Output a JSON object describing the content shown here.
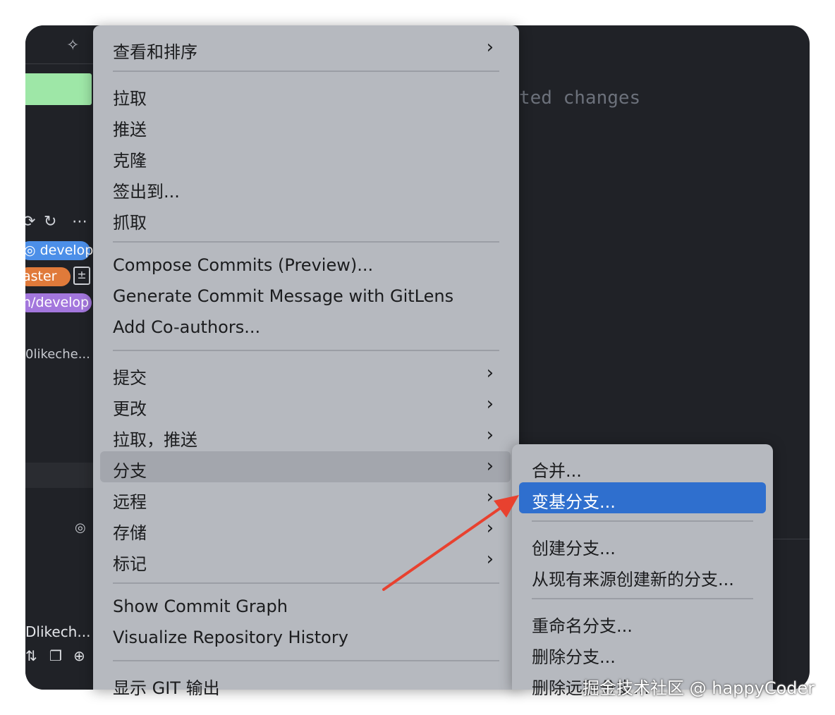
{
  "background_editor_text": "ted changes",
  "sidebar": {
    "branch_labels": [
      "develop",
      "aster",
      "n/develop"
    ],
    "author_top": "0likeche...",
    "author_bottom": "Dlikech...",
    "icons": [
      "sparkle-icon",
      "sync-icon",
      "refresh-icon",
      "more-icon",
      "stash-icon",
      "radio-icon",
      "pull-request-icon",
      "copy-icon",
      "globe-icon"
    ]
  },
  "menu": {
    "items": [
      {
        "label": "查看和排序",
        "submenu": true
      },
      {
        "label": "拉取"
      },
      {
        "label": "推送"
      },
      {
        "label": "克隆"
      },
      {
        "label": "签出到..."
      },
      {
        "label": "抓取"
      },
      {
        "label": "Compose Commits (Preview)..."
      },
      {
        "label": "Generate Commit Message with GitLens"
      },
      {
        "label": "Add Co-authors..."
      },
      {
        "label": "提交",
        "submenu": true
      },
      {
        "label": "更改",
        "submenu": true
      },
      {
        "label": "拉取，推送",
        "submenu": true
      },
      {
        "label": "分支",
        "submenu": true,
        "highlighted": true
      },
      {
        "label": "远程",
        "submenu": true
      },
      {
        "label": "存储",
        "submenu": true
      },
      {
        "label": "标记",
        "submenu": true
      },
      {
        "label": "Show Commit Graph"
      },
      {
        "label": "Visualize Repository History"
      },
      {
        "label": "显示 GIT 输出"
      }
    ],
    "chevron": "›"
  },
  "submenu": {
    "items": [
      {
        "label": "合并..."
      },
      {
        "label": "变基分支...",
        "selected": true
      },
      {
        "label": "创建分支..."
      },
      {
        "label": "从现有来源创建新的分支..."
      },
      {
        "label": "重命名分支..."
      },
      {
        "label": "删除分支..."
      },
      {
        "label": "删除远程分支..."
      }
    ]
  },
  "annotation": {
    "arrow_color": "#e8412f"
  },
  "watermark": "掘金技术社区 @ happyCoder",
  "colors": {
    "menu_bg": "#b6b9bf",
    "selected_bg": "#2f6fce",
    "highlight_bg": "#a3a6ad",
    "window_bg": "#202227",
    "pill_develop": "#4c8fe8",
    "pill_master": "#e07a3a",
    "pill_origin": "#a377dd",
    "green_bar": "#9ee7a7"
  }
}
